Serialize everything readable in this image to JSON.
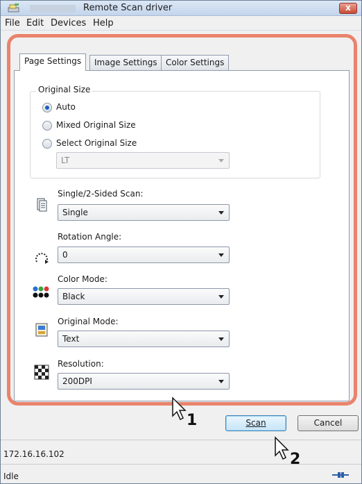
{
  "window": {
    "title": "Remote Scan driver",
    "close_label": "x"
  },
  "menu": [
    "File",
    "Edit",
    "Devices",
    "Help"
  ],
  "tabs": [
    {
      "label": "Page Settings",
      "active": true
    },
    {
      "label": "Image Settings",
      "active": false
    },
    {
      "label": "Color Settings",
      "active": false
    }
  ],
  "original_size": {
    "group_label": "Original Size",
    "options": [
      {
        "label": "Auto",
        "selected": true
      },
      {
        "label": "Mixed Original Size",
        "selected": false
      },
      {
        "label": "Select Original Size",
        "selected": false
      }
    ],
    "size_value": "LT"
  },
  "fields": {
    "sided_label": "Single/2-Sided Scan:",
    "sided_value": "Single",
    "rotation_label": "Rotation Angle:",
    "rotation_value": "0",
    "color_label": "Color Mode:",
    "color_value": "Black",
    "original_mode_label": "Original Mode:",
    "original_mode_value": "Text",
    "resolution_label": "Resolution:",
    "resolution_value": "200DPI"
  },
  "buttons": {
    "scan_label": "Scan",
    "cancel_label": "Cancel"
  },
  "callouts": {
    "first": "1",
    "second": "2"
  },
  "status": {
    "address": "172.16.16.102",
    "state": "Idle"
  },
  "colors": {
    "highlight": "#e9836c",
    "accent": "#1a5fbd"
  }
}
